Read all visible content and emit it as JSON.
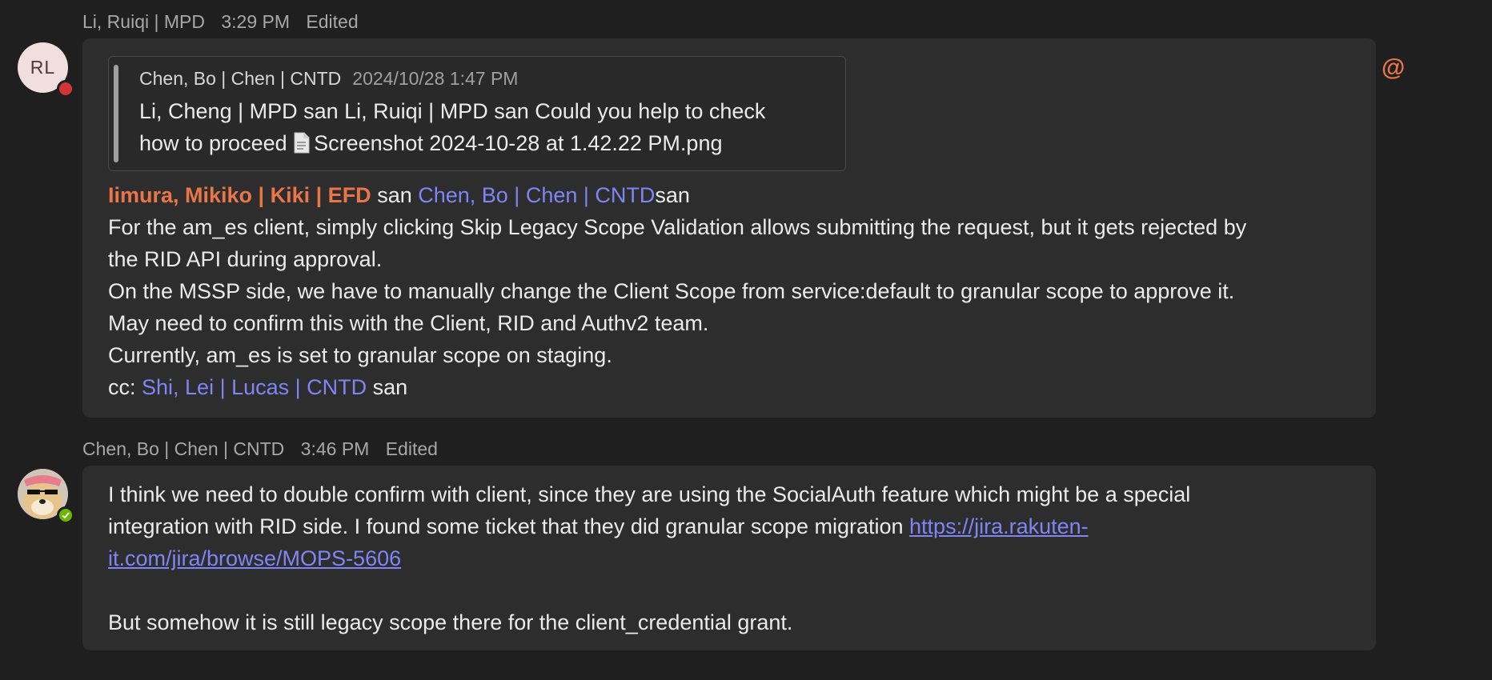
{
  "messages": [
    {
      "sender": "Li, Ruiqi | MPD",
      "time": "3:29 PM",
      "edited": "Edited",
      "avatar_initials": "RL",
      "presence": "busy",
      "quote": {
        "sender": "Chen, Bo | Chen | CNTD",
        "timestamp": "2024/10/28 1:47 PM",
        "line1": "Li, Cheng | MPD san Li, Ruiqi | MPD san Could you help to check",
        "line2_prefix": "how to proceed ",
        "attachment": "Screenshot 2024-10-28 at 1.42.22 PM.png"
      },
      "mention1": "Iimura, Mikiko | Kiki | EFD",
      "san1": " san ",
      "mention2": "Chen, Bo | Chen | CNTD",
      "san2": "san",
      "line_a": "For the am_es client, simply clicking Skip Legacy Scope Validation allows submitting the request, but it gets rejected by",
      "line_b": "the RID API during approval.",
      "line_c": "On the MSSP side, we have to manually change the Client Scope from service:default to granular scope to approve it.",
      "line_d": "May need to confirm this with the Client, RID and Authv2 team.",
      "line_e": "Currently, am_es is set to granular scope on staging.",
      "cc_prefix": "cc: ",
      "cc_mention": "Shi, Lei | Lucas | CNTD",
      "cc_suffix": " san",
      "mention_indicator": "@"
    },
    {
      "sender": "Chen, Bo | Chen | CNTD",
      "time": "3:46 PM",
      "edited": "Edited",
      "presence": "available",
      "line_a": "I think we need to double confirm with client, since they are using the SocialAuth feature which might be a special",
      "line_b_prefix": "integration with RID side. I found some ticket that they did granular scope migration ",
      "link_part1": "https://jira.rakuten-",
      "link_part2": "it.com/jira/browse/MOPS-5606",
      "line_c": "But somehow it is still legacy scope there for the client_credential grant."
    }
  ],
  "colors": {
    "background": "#1f1f1f",
    "bubble": "#2d2d2d",
    "mention_me": "#e97548",
    "mention": "#7f85f5",
    "busy": "#d13438",
    "available": "#6bb700"
  }
}
